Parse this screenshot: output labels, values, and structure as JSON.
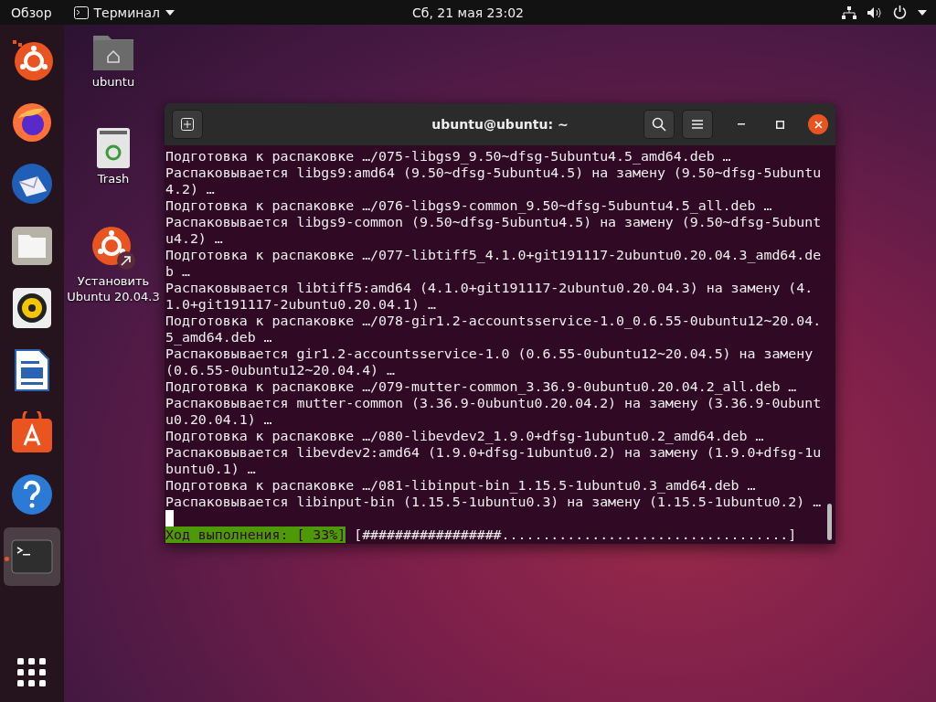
{
  "top_bar": {
    "activities": "Обзор",
    "app_menu": "Терминал",
    "clock": "Сб, 21 мая  23:02"
  },
  "dock": [
    {
      "selected": false,
      "running": false
    },
    {
      "selected": false,
      "running": false
    },
    {
      "selected": false,
      "running": false
    },
    {
      "selected": false,
      "running": false
    },
    {
      "selected": false,
      "running": false
    },
    {
      "selected": false,
      "running": false
    },
    {
      "selected": false,
      "running": false
    },
    {
      "selected": false,
      "running": false
    },
    {
      "selected": true,
      "running": true
    }
  ],
  "desktop_icons": [
    {
      "label": "ubuntu"
    },
    {
      "label": "Trash"
    },
    {
      "label": "Установить Ubuntu 20.04.3"
    }
  ],
  "terminal": {
    "title": "ubuntu@ubuntu: ~",
    "lines": [
      "Подготовка к распаковке …/075-libgs9_9.50~dfsg-5ubuntu4.5_amd64.deb …",
      "Распаковывается libgs9:amd64 (9.50~dfsg-5ubuntu4.5) на замену (9.50~dfsg-5ubuntu4.2) …",
      "Подготовка к распаковке …/076-libgs9-common_9.50~dfsg-5ubuntu4.5_all.deb …",
      "Распаковывается libgs9-common (9.50~dfsg-5ubuntu4.5) на замену (9.50~dfsg-5ubuntu4.2) …",
      "Подготовка к распаковке …/077-libtiff5_4.1.0+git191117-2ubuntu0.20.04.3_amd64.deb …",
      "Распаковывается libtiff5:amd64 (4.1.0+git191117-2ubuntu0.20.04.3) на замену (4.1.0+git191117-2ubuntu0.20.04.1) …",
      "Подготовка к распаковке …/078-gir1.2-accountsservice-1.0_0.6.55-0ubuntu12~20.04.5_amd64.deb …",
      "Распаковывается gir1.2-accountsservice-1.0 (0.6.55-0ubuntu12~20.04.5) на замену (0.6.55-0ubuntu12~20.04.4) …",
      "Подготовка к распаковке …/079-mutter-common_3.36.9-0ubuntu0.20.04.2_all.deb …",
      "Распаковывается mutter-common (3.36.9-0ubuntu0.20.04.2) на замену (3.36.9-0ubuntu0.20.04.1) …",
      "Подготовка к распаковке …/080-libevdev2_1.9.0+dfsg-1ubuntu0.2_amd64.deb …",
      "Распаковывается libevdev2:amd64 (1.9.0+dfsg-1ubuntu0.2) на замену (1.9.0+dfsg-1ubuntu0.1) …",
      "Подготовка к распаковке …/081-libinput-bin_1.15.5-1ubuntu0.3_amd64.deb …",
      "Распаковывается libinput-bin (1.15.5-1ubuntu0.3) на замену (1.15.5-1ubuntu0.2) …"
    ],
    "progress": {
      "label": "Ход выполнения: [ 33%]",
      "bar": "[#################...................................]"
    }
  }
}
